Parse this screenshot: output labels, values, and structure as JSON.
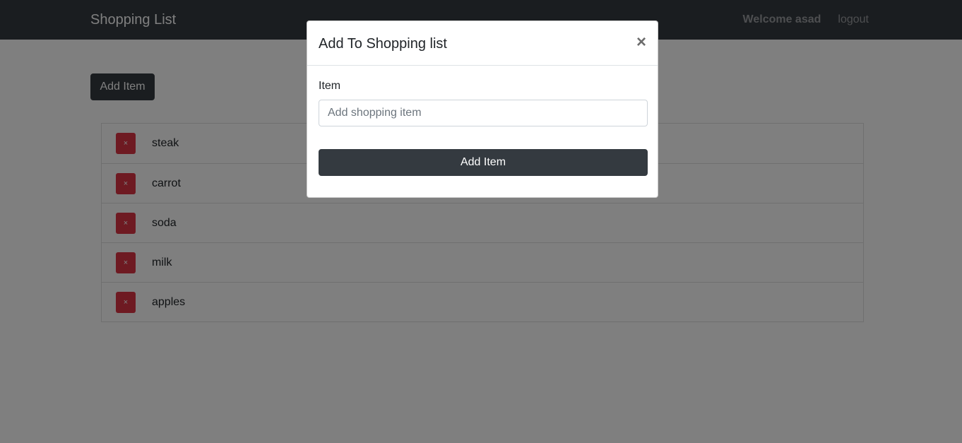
{
  "navbar": {
    "brand": "Shopping List",
    "welcome": "Welcome asad",
    "logout": "logout"
  },
  "main": {
    "add_item_label": "Add Item",
    "remove_icon": "×",
    "items": [
      {
        "name": "steak"
      },
      {
        "name": "carrot"
      },
      {
        "name": "soda"
      },
      {
        "name": "milk"
      },
      {
        "name": "apples"
      }
    ]
  },
  "modal": {
    "title": "Add To Shopping list",
    "close": "×",
    "field_label": "Item",
    "input_placeholder": "Add shopping item",
    "input_value": "",
    "submit_label": "Add Item"
  },
  "colors": {
    "navbar": "#343a40",
    "danger": "#dc3545",
    "primary_button": "#343a40"
  },
  "icons": {
    "remove": "close-icon",
    "modal_close": "close-icon"
  }
}
